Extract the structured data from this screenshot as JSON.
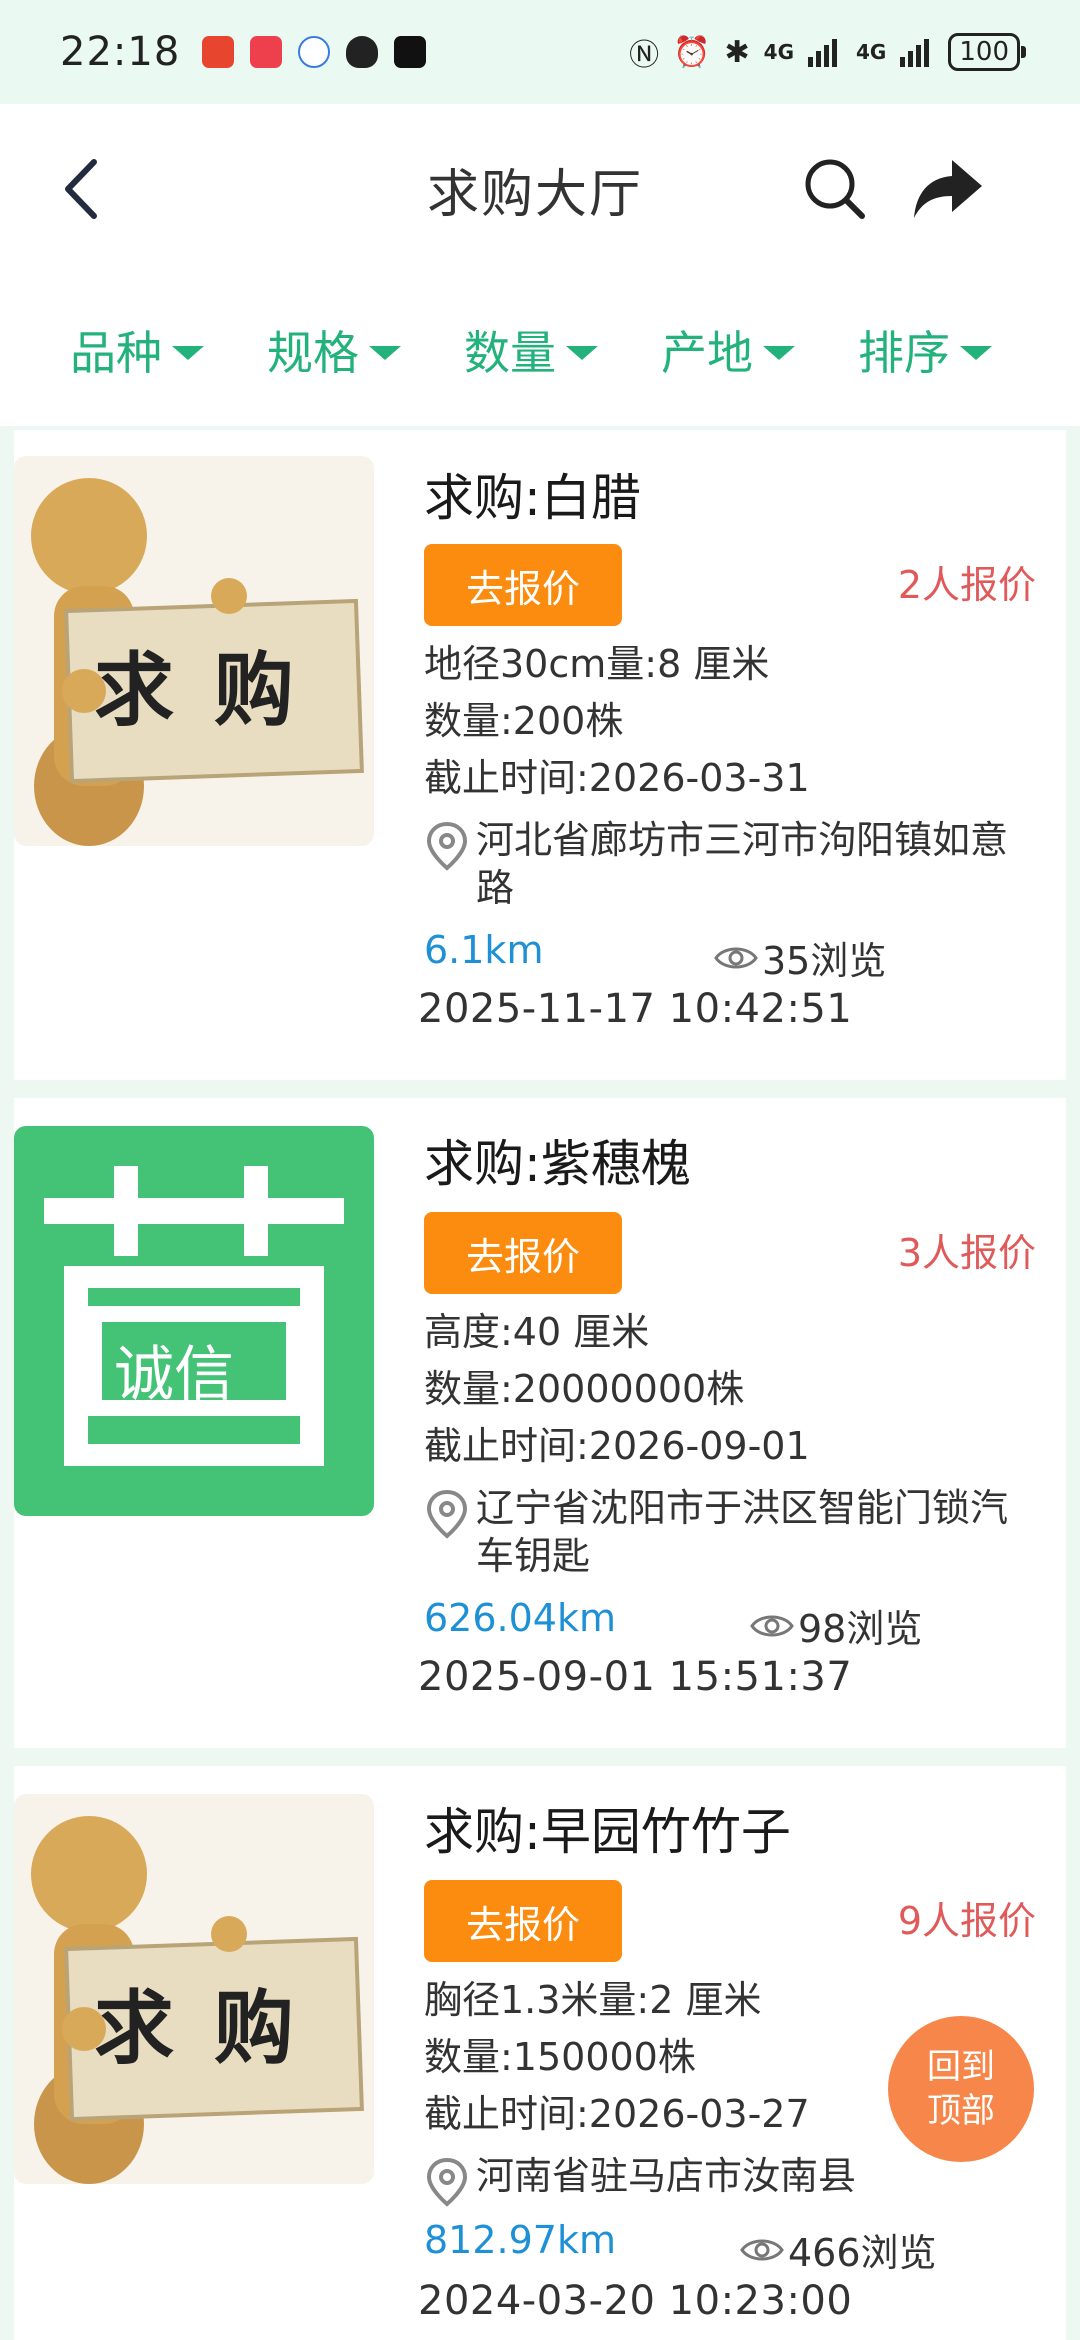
{
  "status_bar": {
    "time": "22:18",
    "network_1": "4G",
    "network_2": "4G",
    "battery": "100"
  },
  "header": {
    "title": "求购大厅",
    "back_icon": "chevron-left-icon",
    "search_icon": "search-icon",
    "share_icon": "share-icon"
  },
  "filters": [
    {
      "label": "品种"
    },
    {
      "label": "规格"
    },
    {
      "label": "数量"
    },
    {
      "label": "产地"
    },
    {
      "label": "排序"
    }
  ],
  "items": [
    {
      "title": "求购:白腊",
      "quote_button": "去报价",
      "quote_count": "2人报价",
      "spec": "地径30cm量:8 厘米",
      "quantity": "数量:200株",
      "deadline": "截止时间:2026-03-31",
      "address_line1": "河北省廊坊市三河市泃阳镇如意",
      "address_line2": "路",
      "distance": "6.1km",
      "views": "35浏览",
      "date": "2025-11-17 10:42:51",
      "image": "qiugou-image",
      "image_text": "求 购"
    },
    {
      "title": "求购:紫穗槐",
      "quote_button": "去报价",
      "quote_count": "3人报价",
      "spec": "高度:40 厘米",
      "quantity": "数量:20000000株",
      "deadline": "截止时间:2026-09-01",
      "address_line1": "辽宁省沈阳市于洪区智能门锁汽",
      "address_line2": "车钥匙",
      "distance": "626.04km",
      "views": "98浏览",
      "date": "2025-09-01 15:51:37",
      "image": "chengxin-logo",
      "image_text": "诚信"
    },
    {
      "title": "求购:早园竹竹子",
      "quote_button": "去报价",
      "quote_count": "9人报价",
      "spec": "胸径1.3米量:2 厘米",
      "quantity": "数量:150000株",
      "deadline": "截止时间:2026-03-27",
      "address_line1": "河南省驻马店市汝南县",
      "address_line2": "",
      "distance": "812.97km",
      "views": "466浏览",
      "date": "2024-03-20 10:23:00",
      "image": "qiugou-image",
      "image_text": "求 购"
    }
  ],
  "back_to_top": {
    "line1": "回到",
    "line2": "顶部"
  },
  "colors": {
    "accent_green": "#23b27b",
    "button_orange": "#fb8c10",
    "quote_red": "#e15a5a",
    "distance_blue": "#1e90d6",
    "back_top": "#f7864a"
  }
}
